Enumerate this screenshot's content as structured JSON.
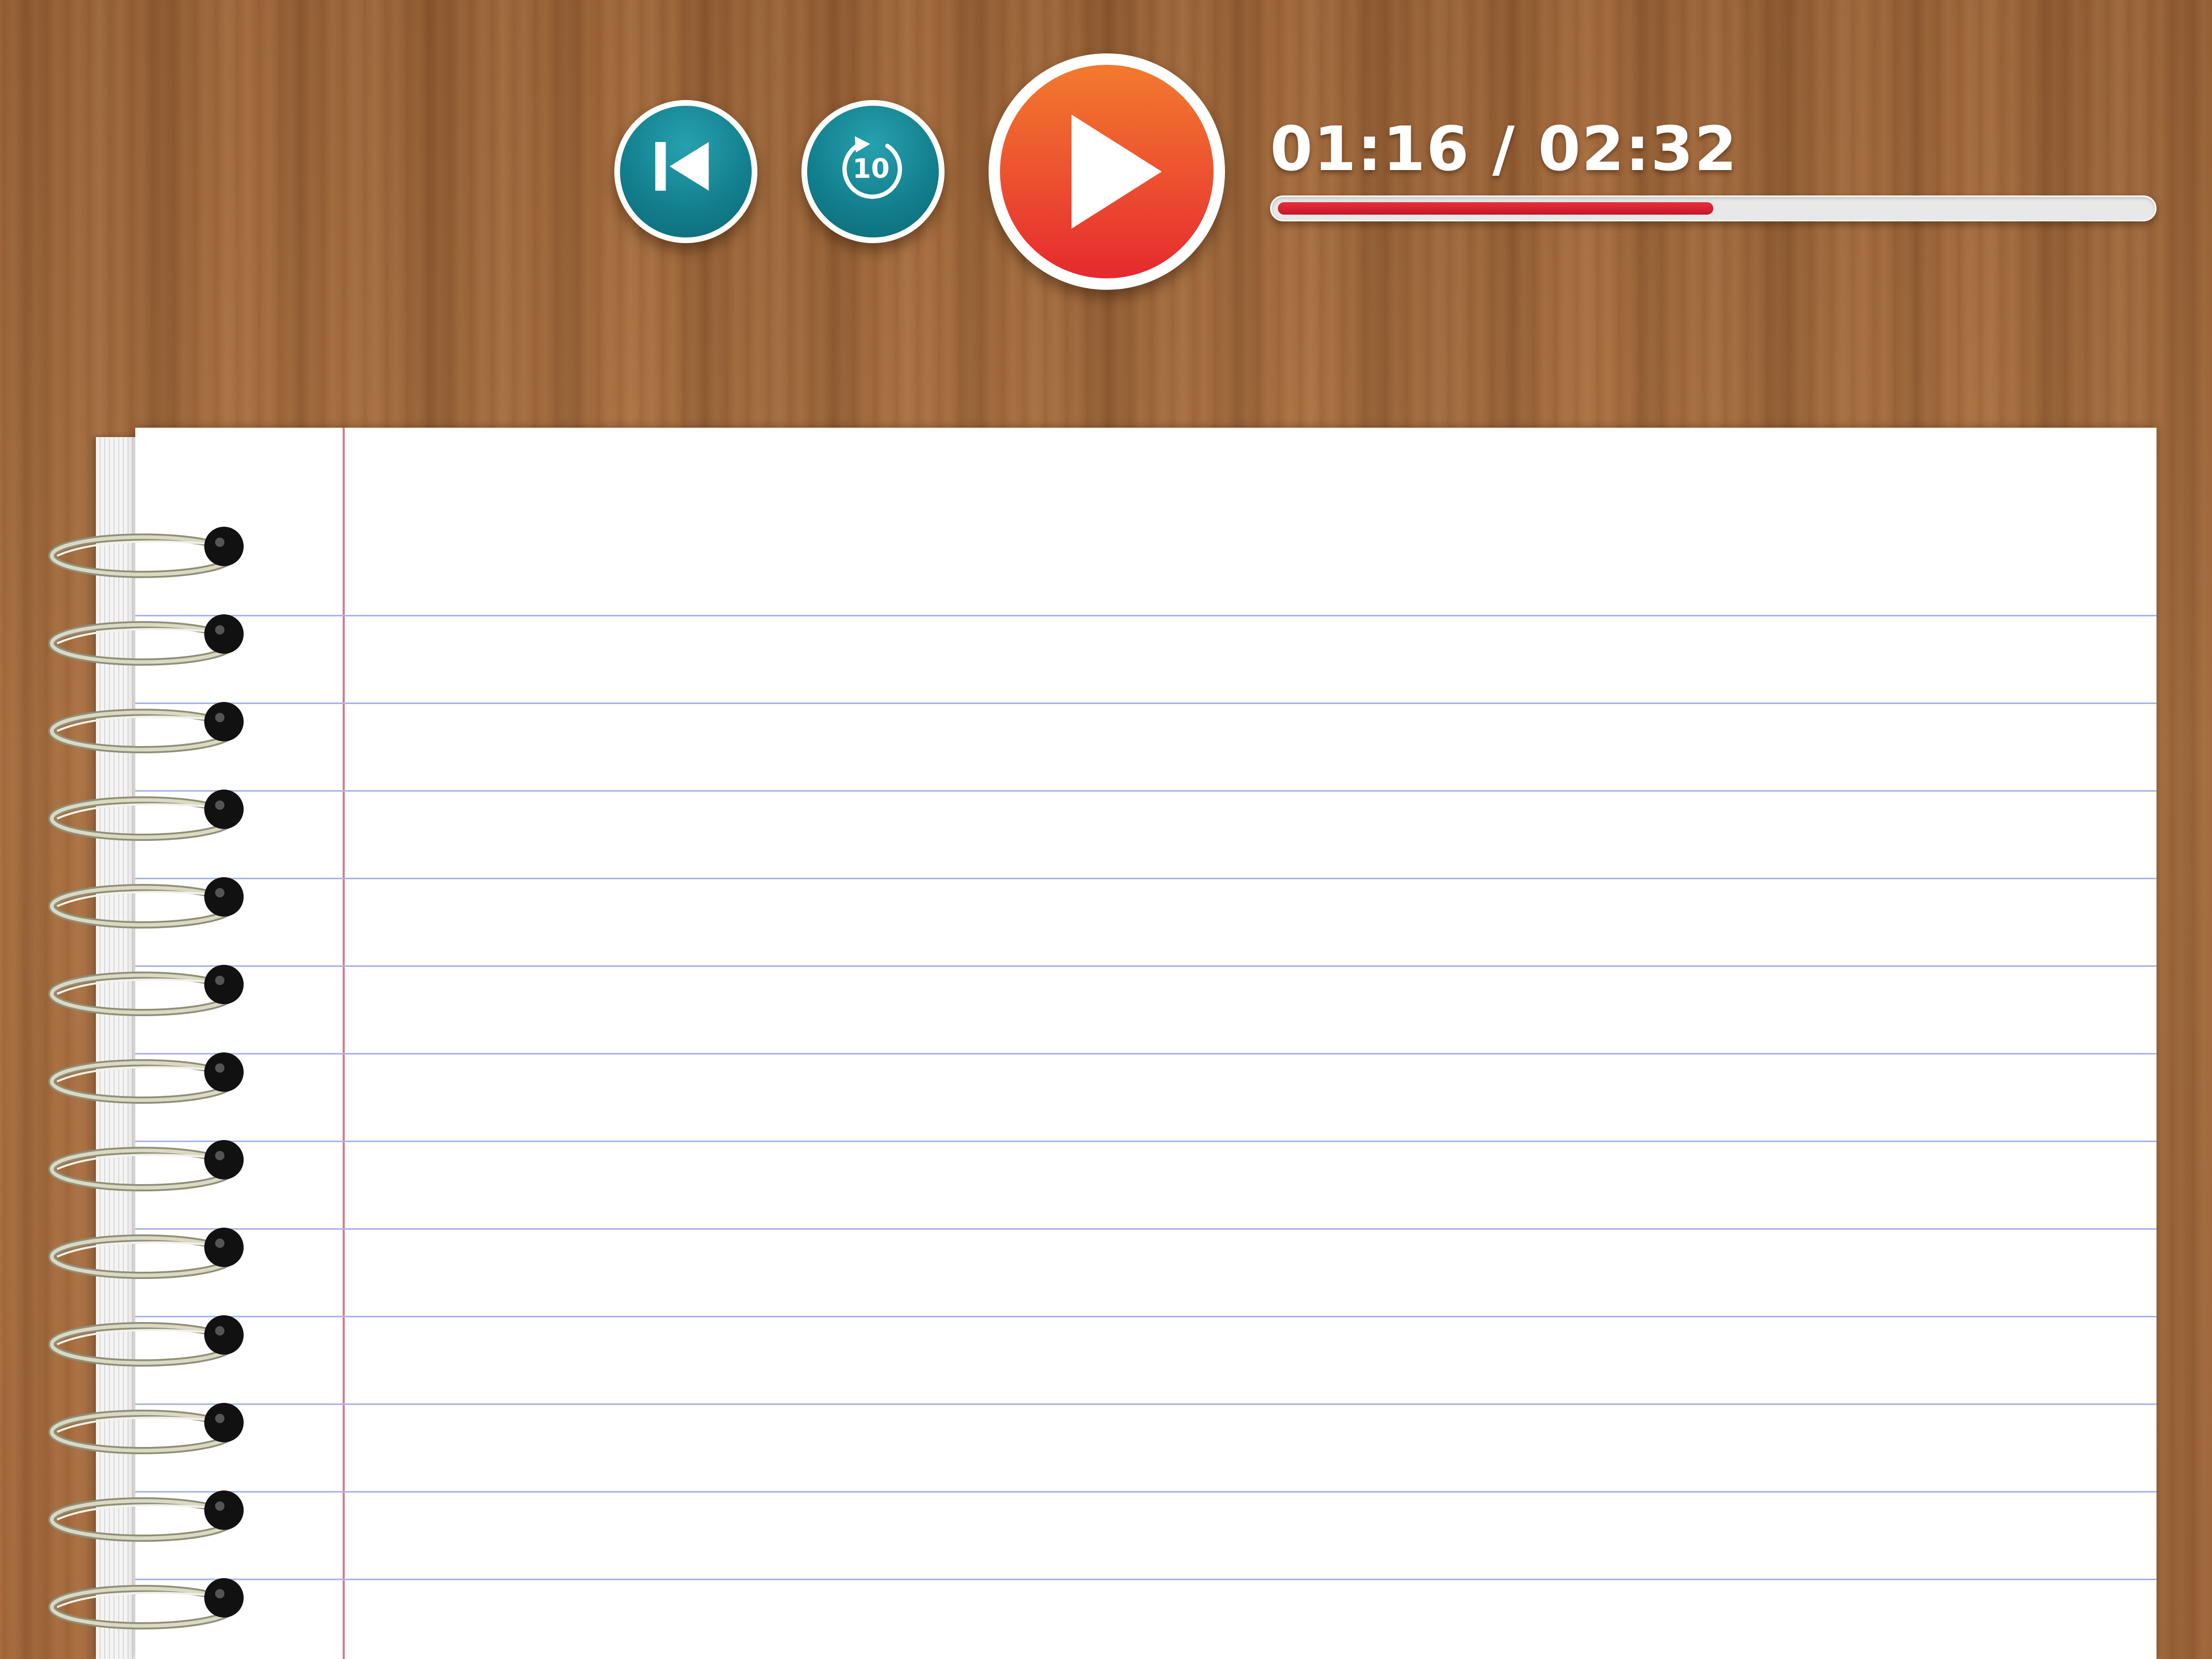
{
  "player": {
    "controls": [
      {
        "id": "skip-back",
        "icon": "skip-back-icon"
      },
      {
        "id": "replay-10",
        "icon": "replay-10-icon",
        "badge": "10"
      },
      {
        "id": "play",
        "icon": "play-icon"
      }
    ],
    "replay_badge": "10",
    "time_display": "01:16 / 02:32",
    "progress": {
      "elapsed": "01:16",
      "total": "02:32",
      "fraction": 0.5
    },
    "colors": {
      "teal_button": "#13808f",
      "play_top": "#f27a2d",
      "play_bottom": "#e6292e",
      "progress_fill": "#d61f30",
      "progress_track": "#e8e8e8"
    }
  },
  "notebook": {
    "ruled_lines": 12,
    "spiral_rings": 13,
    "colors": {
      "paper": "#ffffff",
      "rule_line": "#aab2ee",
      "margin_line": "#d7798a"
    }
  }
}
